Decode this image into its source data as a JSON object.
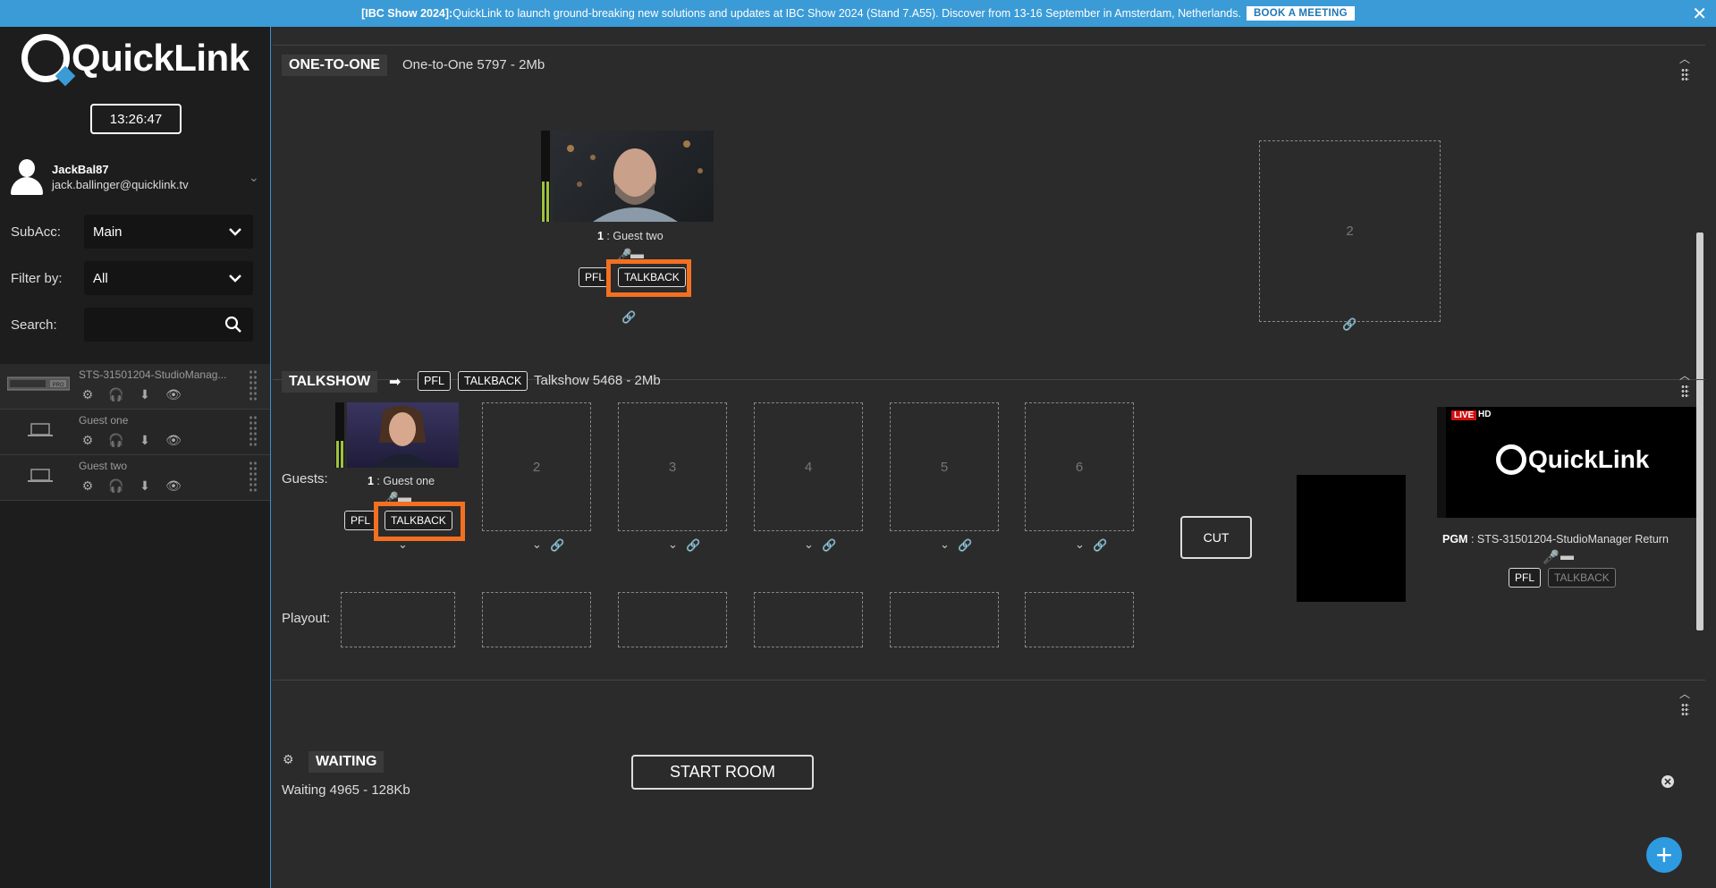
{
  "banner": {
    "bold": "[IBC Show 2024]:",
    "text": " QuickLink to launch ground-breaking new solutions and updates at IBC Show 2024 (Stand 7.A55). Discover from 13-16 September in Amsterdam, Netherlands.",
    "button": "BOOK A MEETING",
    "close": "✕"
  },
  "sidebar": {
    "logo_text": "QuickLink",
    "clock": "13:26:47",
    "user": {
      "name": "JackBal87",
      "email": "jack.ballinger@quicklink.tv"
    },
    "subacc": {
      "label": "SubAcc:",
      "value": "Main"
    },
    "filter": {
      "label": "Filter by:",
      "value": "All"
    },
    "search": {
      "label": "Search:",
      "placeholder": ""
    },
    "devices": [
      {
        "name": "STS-31501204-StudioManag...",
        "badge": "PRO"
      },
      {
        "name": "Guest one"
      },
      {
        "name": "Guest two"
      }
    ]
  },
  "one_to_one": {
    "tag": "ONE-TO-ONE",
    "title": "One-to-One 5797 - 2Mb",
    "guest": {
      "num": "1",
      "name": " : Guest two"
    },
    "pfl": "PFL",
    "talkback": "TALKBACK",
    "slot2": "2"
  },
  "talkshow": {
    "tag": "TALKSHOW",
    "pfl": "PFL",
    "talkback": "TALKBACK",
    "title": "Talkshow 5468 - 2Mb",
    "guests_label": "Guests:",
    "playout_label": "Playout:",
    "guest1": {
      "num": "1",
      "name": " : Guest one"
    },
    "slots": [
      "2",
      "3",
      "4",
      "5",
      "6"
    ],
    "cut": "CUT",
    "pgm": {
      "live": "LIVE",
      "hd": "HD",
      "logo": "QuickLink",
      "label": "PGM",
      "name": " : STS-31501204-StudioManager Return"
    },
    "pgm_pfl": "PFL",
    "pgm_talkback": "TALKBACK"
  },
  "waiting": {
    "tag": "WAITING",
    "title": "Waiting 4965 - 128Kb",
    "start": "START ROOM"
  },
  "colors": {
    "accent": "#3b9bd6",
    "highlight": "#f37021",
    "meter": "#9fc23e"
  }
}
